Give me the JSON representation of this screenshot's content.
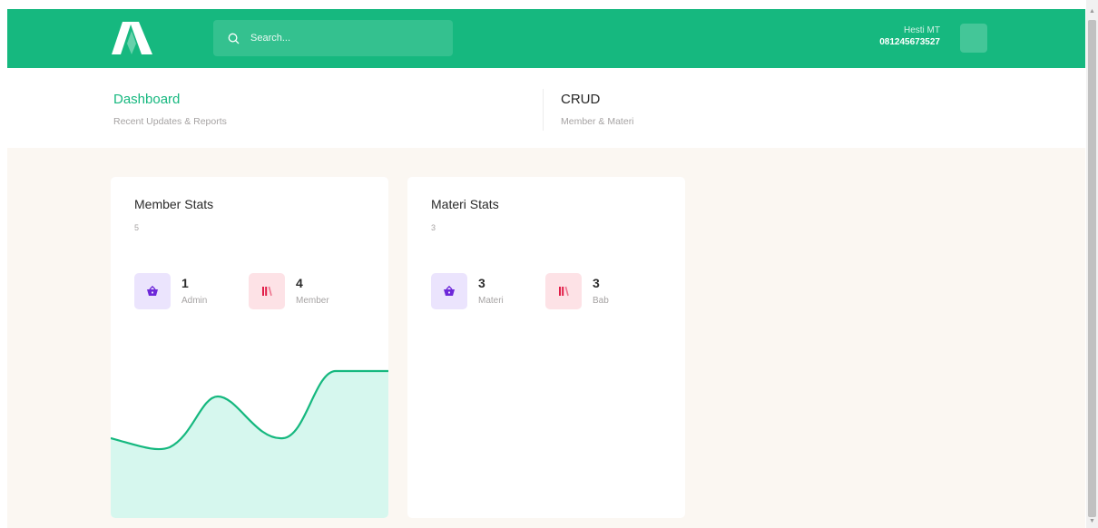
{
  "header": {
    "search": {
      "placeholder": "Search..."
    },
    "user": {
      "name": "Hesti MT",
      "phone": "081245673527"
    }
  },
  "nav": [
    {
      "title": "Dashboard",
      "subtitle": "Recent Updates & Reports",
      "active": true
    },
    {
      "title": "CRUD",
      "subtitle": "Member & Materi",
      "active": false
    }
  ],
  "cards": {
    "member": {
      "title": "Member Stats",
      "total": "5",
      "stats": [
        {
          "value": "1",
          "label": "Admin",
          "icon": "basket-icon"
        },
        {
          "value": "4",
          "label": "Member",
          "icon": "books-icon"
        }
      ]
    },
    "materi": {
      "title": "Materi Stats",
      "total": "3",
      "stats": [
        {
          "value": "3",
          "label": "Materi",
          "icon": "basket-icon"
        },
        {
          "value": "3",
          "label": "Bab",
          "icon": "books-icon"
        }
      ]
    }
  },
  "colors": {
    "brand": "#16b87f",
    "chart_fill": "#d6f7ee",
    "purple_icon": "#6d28d9",
    "pink_icon": "#e11d48"
  }
}
